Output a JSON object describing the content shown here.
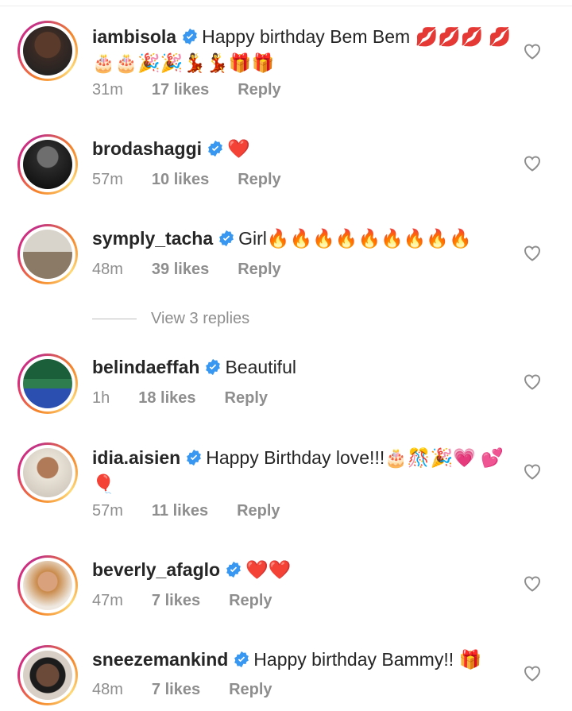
{
  "comments": [
    {
      "username": "iambisola",
      "text": "Happy birthday Bem Bem 💋💋💋 💋🎂🎂🎉🎉💃💃🎁🎁",
      "time": "31m",
      "likes": "17 likes",
      "reply": "Reply"
    },
    {
      "username": "brodashaggi",
      "text": "❤️",
      "time": "57m",
      "likes": "10 likes",
      "reply": "Reply"
    },
    {
      "username": "symply_tacha",
      "text": "Girl🔥🔥🔥🔥🔥🔥🔥🔥🔥",
      "time": "48m",
      "likes": "39 likes",
      "reply": "Reply"
    },
    {
      "username": "belindaeffah",
      "text": "Beautiful",
      "time": "1h",
      "likes": "18 likes",
      "reply": "Reply"
    },
    {
      "username": "idia.aisien",
      "text": "Happy Birthday love!!!🎂🎊🎉💗 💕🎈",
      "time": "57m",
      "likes": "11 likes",
      "reply": "Reply"
    },
    {
      "username": "beverly_afaglo",
      "text": "❤️❤️",
      "time": "47m",
      "likes": "7 likes",
      "reply": "Reply"
    },
    {
      "username": "sneezemankind",
      "text": "Happy birthday Bammy!! 🎁",
      "time": "48m",
      "likes": "7 likes",
      "reply": "Reply"
    }
  ],
  "view_replies": "View 3 replies",
  "colors": {
    "text": "#262626",
    "meta": "#8e8e8e",
    "verified": "#3897f0"
  }
}
